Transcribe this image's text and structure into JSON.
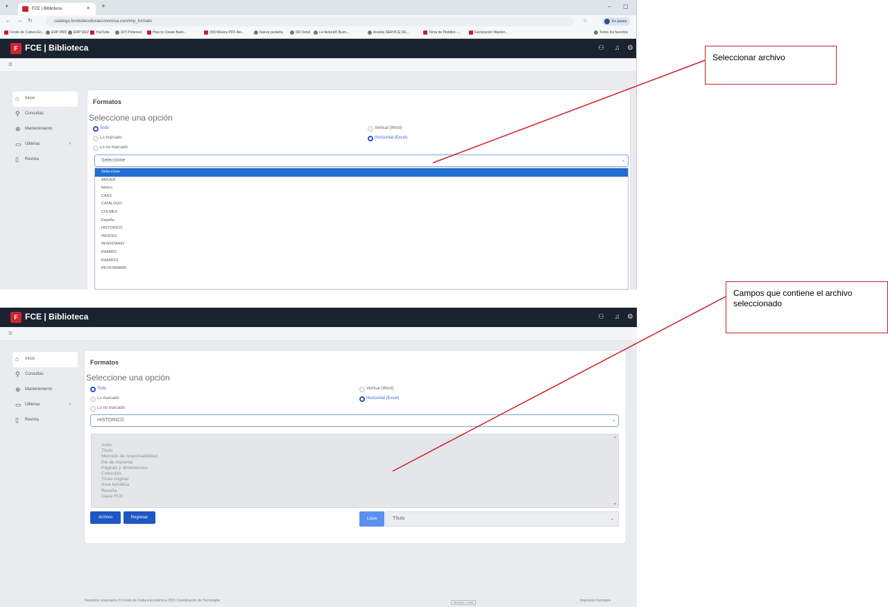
{
  "colors": {
    "appbar": "#1b2330",
    "brand": "#d02230",
    "primary": "#1f56c5",
    "selected_option": "#1f6ed4",
    "annotation": "#d01e26"
  },
  "browser": {
    "tab_title": "FCE | Biblioteca",
    "url": "catalogo.fondodeculturaeconomica.com/imp_formato",
    "profile_label": "En pausa",
    "bookmarks": [
      "Fondo de Cultura Ec...",
      "ERP PRD",
      "ERP DEV",
      "YouTube",
      "(47) Pinterest",
      "How to Create Bank...",
      "(59) Música PDF Ale...",
      "Nueva pestaña",
      "SR Detail",
      "i-e-factura® Buzn...",
      "Aranda SERVICE DE...",
      "Toma de Pedidos -...",
      "Facturación Manten..."
    ],
    "all_bookmarks": "Todos los favoritos"
  },
  "app": {
    "logo_mark": "F",
    "title": "FCE | Biblioteca",
    "sidebar": [
      "Inicio",
      "Consultas",
      "Mantenimiento",
      "Utilerias",
      "Revista"
    ],
    "card_title": "Formatos",
    "subtitle": "Seleccione una opción",
    "radios": {
      "todo": "Todo",
      "lo_marcado": "Lo marcado",
      "lo_no_marcado": "Lo no marcado",
      "vertical": "Vertical (Word)",
      "horizontal": "Horizontal (Excel)"
    }
  },
  "shot1": {
    "select_value": "Seleccione",
    "options": [
      "Seleccione",
      "ANIVER",
      "básico",
      "CASS",
      "CATALOGO",
      "COLMEX",
      "España",
      "HISTORICO",
      "INDICES",
      "INVENTARIO",
      "RAMIRO",
      "RAMIRO1",
      "REYESRAMIR"
    ]
  },
  "shot2": {
    "select_value": "HISTORICO",
    "fields": [
      "Autor",
      "Título",
      "Mención de responsabilidad",
      "Pie de imprenta",
      "Páginas y dimensiones",
      "Colección",
      "Título original",
      "Área temática",
      "Reseña",
      "Clave FCE"
    ],
    "buttons": {
      "archivo": "Archivo",
      "regresar": "Regresar",
      "llave": "Llave"
    },
    "order_value": "Título",
    "footer_left": "Derechos reservados © Fondo de Cultura Económica 2021 Coordinación de Tecnología",
    "footer_note": "Sin título - Paint",
    "footer_right": "Impresión Formatos"
  },
  "annotations": {
    "callout1": "Seleccionar archivo",
    "callout2": "Campos que contiene el archivo seleccionado"
  }
}
